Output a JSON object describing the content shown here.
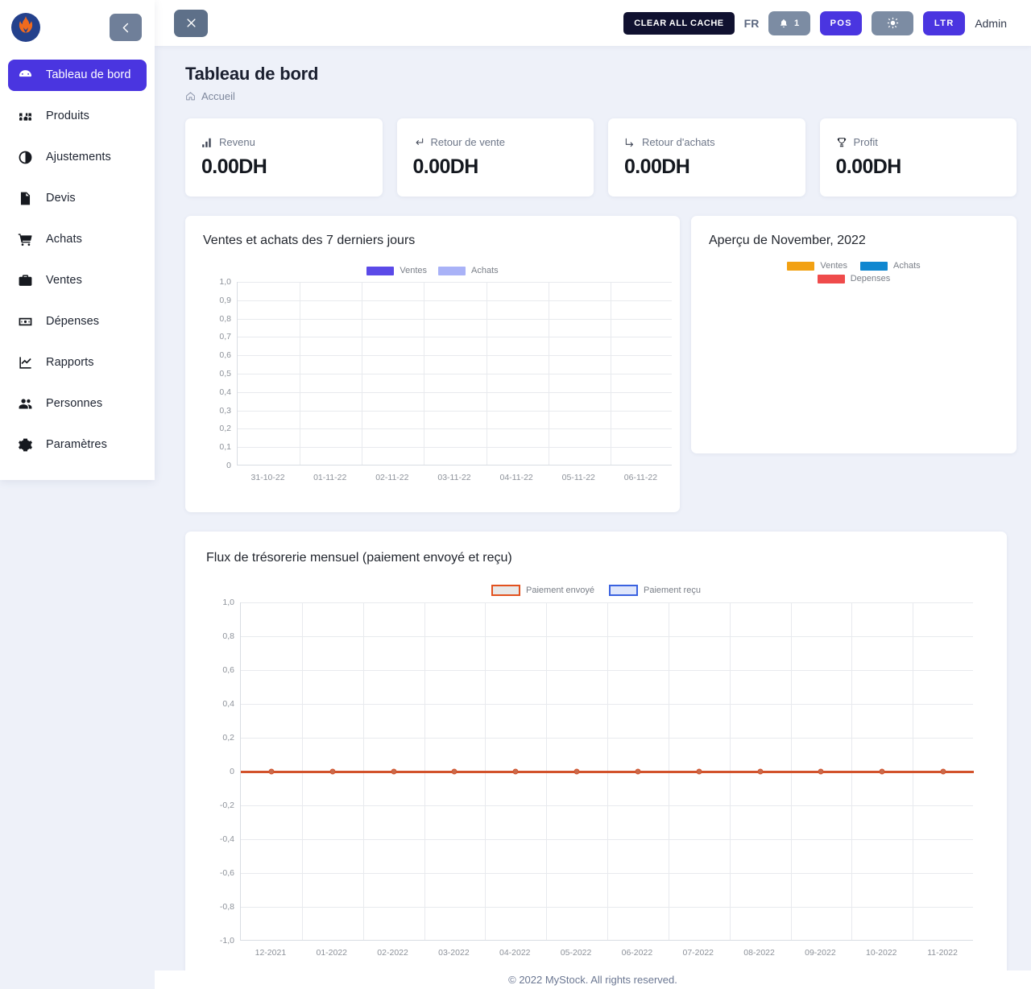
{
  "brand": {
    "logo_icon": "flame-logo",
    "collapse_icon": "chevron-left-icon"
  },
  "sidebar": {
    "items": [
      {
        "label": "Tableau de bord",
        "icon": "dashboard-icon",
        "active": true
      },
      {
        "label": "Produits",
        "icon": "boxes-icon",
        "active": false
      },
      {
        "label": "Ajustements",
        "icon": "half-circle-icon",
        "active": false
      },
      {
        "label": "Devis",
        "icon": "quote-document-icon",
        "active": false
      },
      {
        "label": "Achats",
        "icon": "shopping-cart-icon",
        "active": false
      },
      {
        "label": "Ventes",
        "icon": "briefcase-icon",
        "active": false
      },
      {
        "label": "Dépenses",
        "icon": "money-bill-icon",
        "active": false
      },
      {
        "label": "Rapports",
        "icon": "chart-line-icon",
        "active": false
      },
      {
        "label": "Personnes",
        "icon": "users-icon",
        "active": false
      },
      {
        "label": "Paramètres",
        "icon": "gear-icon",
        "active": false
      }
    ]
  },
  "topbar": {
    "close_icon": "close-icon",
    "clear_cache_label": "CLEAR ALL CACHE",
    "language": "FR",
    "notification_icon": "bell-icon",
    "notification_count": "1",
    "pos_label": "POS",
    "theme_icon": "sun-icon",
    "direction_label": "LTR",
    "user_label": "Admin"
  },
  "page": {
    "title": "Tableau de bord",
    "breadcrumb_icon": "home-icon",
    "breadcrumb": "Accueil"
  },
  "stats": [
    {
      "label": "Revenu",
      "value": "0.00DH",
      "icon": "bar-chart-icon"
    },
    {
      "label": "Retour de vente",
      "value": "0.00DH",
      "icon": "return-arrow-icon"
    },
    {
      "label": "Retour d'achats",
      "value": "0.00DH",
      "icon": "arrow-turn-icon"
    },
    {
      "label": "Profit",
      "value": "0.00DH",
      "icon": "trophy-icon"
    }
  ],
  "cards": {
    "sales": {
      "title": "Ventes et achats des 7 derniers jours"
    },
    "overview": {
      "title": "Aperçu de November, 2022"
    },
    "cashflow": {
      "title": "Flux de trésorerie mensuel (paiement envoyé et reçu)"
    }
  },
  "colors": {
    "accent_indigo": "#4a35e0",
    "ventes_bar": "#5b4ae8",
    "achats_bar": "#a9b2f7",
    "ventes_orange": "#f2a113",
    "achats_blue": "#1087d0",
    "depenses_red": "#ef4b4b",
    "paiement_envoye": "#e2511e",
    "paiement_recu": "#3a62e0",
    "line_orange": "#d2522b",
    "page_bg": "#eef1f9",
    "dark_button": "#101130"
  },
  "chart_data": [
    {
      "id": "sales_purchases_7days",
      "type": "bar",
      "title": "Ventes et achats des 7 derniers jours",
      "categories": [
        "31-10-22",
        "01-11-22",
        "02-11-22",
        "03-11-22",
        "04-11-22",
        "05-11-22",
        "06-11-22"
      ],
      "series": [
        {
          "name": "Ventes",
          "color": "#5b4ae8",
          "values": [
            0,
            0,
            0,
            0,
            0,
            0,
            0
          ]
        },
        {
          "name": "Achats",
          "color": "#a9b2f7",
          "values": [
            0,
            0,
            0,
            0,
            0,
            0,
            0
          ]
        }
      ],
      "yticks": [
        "1,0",
        "0,9",
        "0,8",
        "0,7",
        "0,6",
        "0,5",
        "0,4",
        "0,3",
        "0,2",
        "0,1",
        "0"
      ],
      "ylim": [
        0,
        1
      ],
      "xlabel": "",
      "ylabel": "",
      "grid": true,
      "legend_position": "top-center"
    },
    {
      "id": "overview_november_2022",
      "type": "pie",
      "title": "Aperçu de November, 2022",
      "categories": [
        "Ventes",
        "Achats",
        "Depenses"
      ],
      "values": [
        0,
        0,
        0
      ],
      "series": [
        {
          "name": "Ventes",
          "color": "#f2a113",
          "values": [
            0
          ]
        },
        {
          "name": "Achats",
          "color": "#1087d0",
          "values": [
            0
          ]
        },
        {
          "name": "Depenses",
          "color": "#ef4b4b",
          "values": [
            0
          ]
        }
      ],
      "grid": false,
      "legend_position": "top-center",
      "note": "no data rendered"
    },
    {
      "id": "monthly_cash_flow",
      "type": "line",
      "title": "Flux de trésorerie mensuel (paiement envoyé et reçu)",
      "categories": [
        "12-2021",
        "01-2022",
        "02-2022",
        "03-2022",
        "04-2022",
        "05-2022",
        "06-2022",
        "07-2022",
        "08-2022",
        "09-2022",
        "10-2022",
        "11-2022"
      ],
      "series": [
        {
          "name": "Paiement envoyé",
          "color": "#e2511e",
          "values": [
            0,
            0,
            0,
            0,
            0,
            0,
            0,
            0,
            0,
            0,
            0,
            0
          ]
        },
        {
          "name": "Paiement reçu",
          "color": "#3a62e0",
          "values": [
            0,
            0,
            0,
            0,
            0,
            0,
            0,
            0,
            0,
            0,
            0,
            0
          ]
        }
      ],
      "yticks": [
        "1,0",
        "0,8",
        "0,6",
        "0,4",
        "0,2",
        "0",
        "-0,2",
        "-0,4",
        "-0,6",
        "-0,8",
        "-1,0"
      ],
      "ylim": [
        -1,
        1
      ],
      "xlabel": "",
      "ylabel": "",
      "grid": true,
      "legend_position": "top-right"
    }
  ],
  "footer": {
    "text": "© 2022 MyStock. All rights reserved."
  }
}
